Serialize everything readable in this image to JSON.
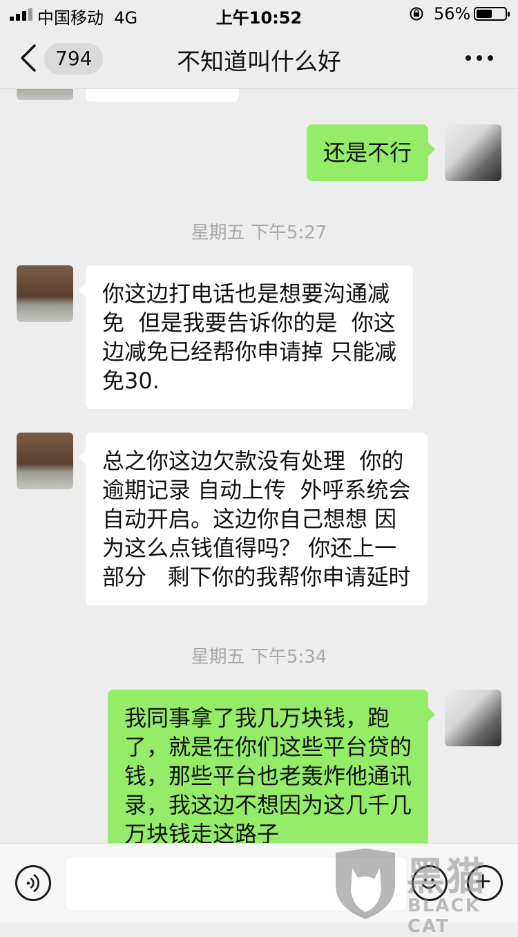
{
  "status_bar": {
    "carrier": "中国移动",
    "network": "4G",
    "time": "上午10:52",
    "battery_pct": "56%",
    "battery_level": 0.56
  },
  "nav": {
    "unread_count": "794",
    "title": "不知道叫什么好"
  },
  "messages": [
    {
      "side": "out",
      "text": "还是不行"
    },
    {
      "timestamp": "星期五 下午5:27"
    },
    {
      "side": "in",
      "text": "你这边打电话也是想要沟通减\n免  但是我要告诉你的是  你这\n边减免已经帮你申请掉 只能减\n免30."
    },
    {
      "side": "in",
      "text": "总之你这边欠款没有处理  你的\n逾期记录 自动上传  外呼系统会\n自动开启。这边你自己想想 因\n为这么点钱值得吗？ 你还上一\n部分   剩下你的我帮你申请延时"
    },
    {
      "timestamp": "星期五 下午5:34"
    },
    {
      "side": "out",
      "text": "我同事拿了我几万块钱，跑\n了，就是在你们这些平台贷的\n钱，那些平台也老轰炸他通讯\n录，我这边不想因为这几千几\n万块钱走这路子"
    }
  ],
  "watermark": {
    "cn": "黑猫",
    "en": "BLACK CAT"
  },
  "icons": {
    "back": "chevron-left-icon",
    "more": "more-dots-icon",
    "voice": "voice-icon",
    "emoji": "emoji-icon",
    "plus": "plus-icon"
  }
}
